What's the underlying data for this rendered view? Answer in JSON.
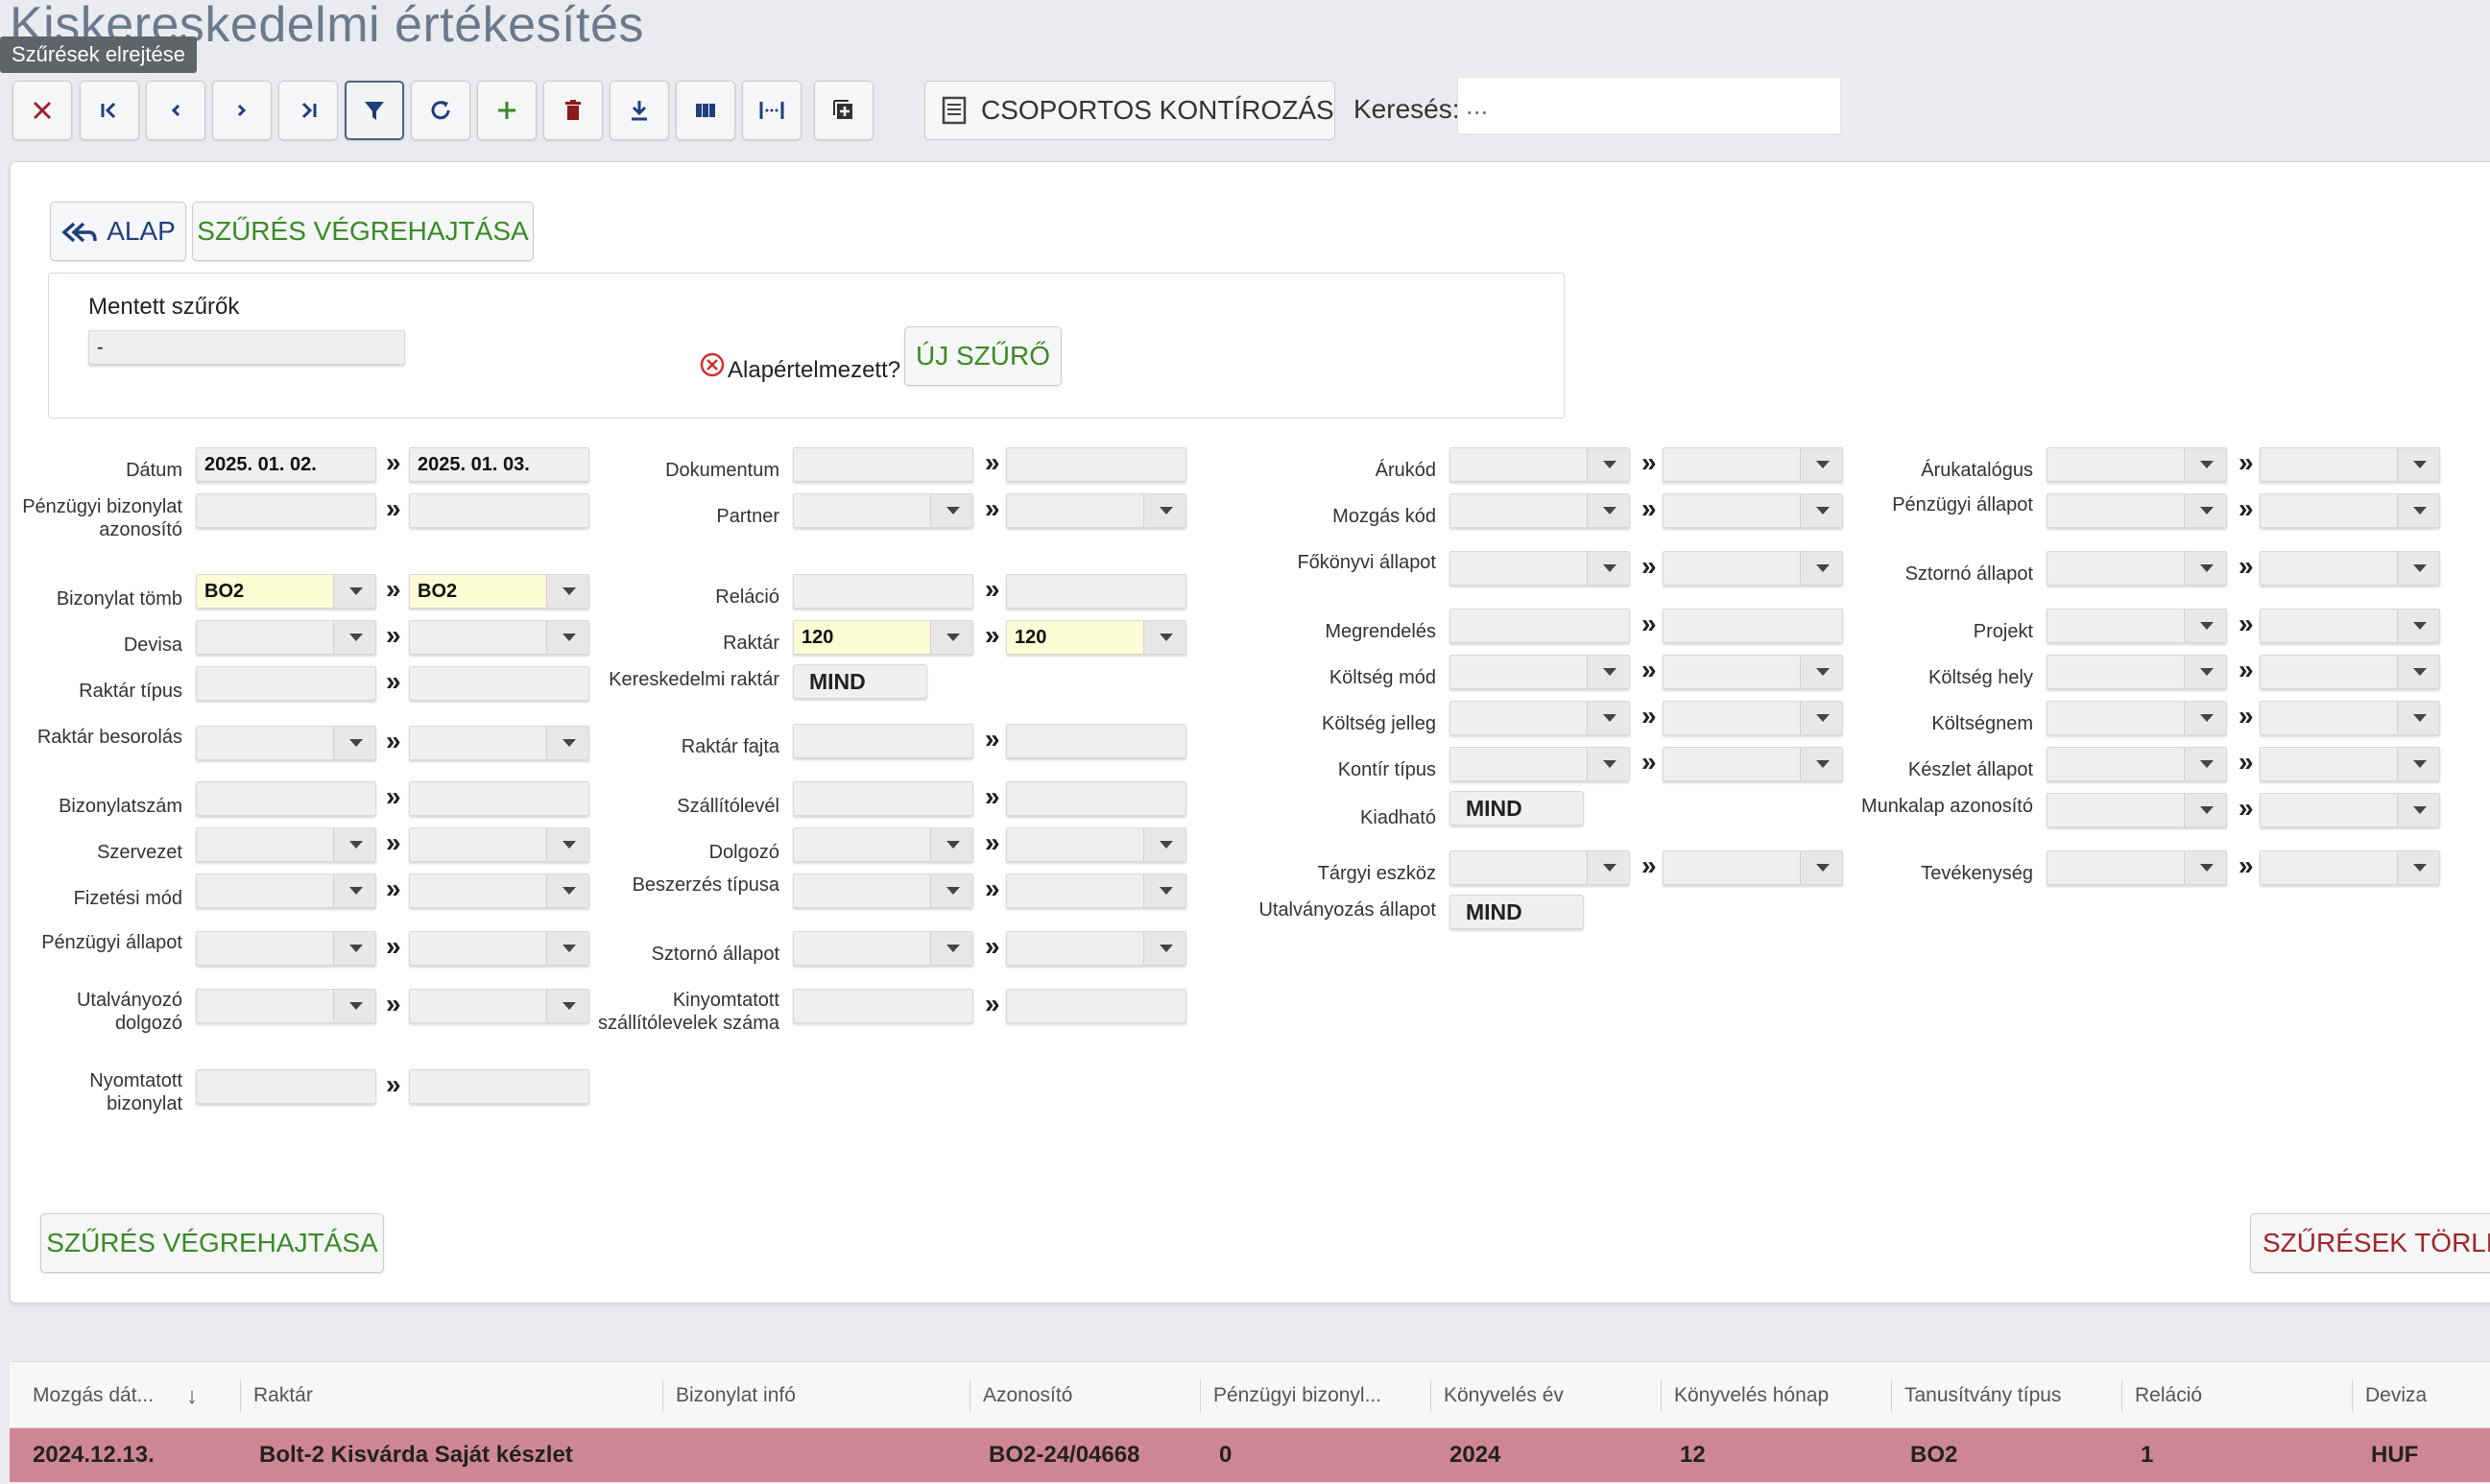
{
  "page": {
    "title": "Kiskereskedelmi értékesítés",
    "tooltip": "Szűrések elrejtése"
  },
  "toolbar": {
    "buttons": [
      "close",
      "first",
      "prev",
      "next",
      "last",
      "filter",
      "refresh",
      "add",
      "delete",
      "download",
      "columns",
      "spacing",
      "new-window"
    ],
    "group_label": "CSOPORTOS KONTÍROZÁS",
    "search_label": "Keresés:",
    "search_placeholder": "..."
  },
  "filters": {
    "back_label": "ALAP",
    "apply_label": "SZŰRÉS VÉGREHAJTÁSA",
    "saved_title": "Mentett szűrők",
    "saved_value": "-",
    "default_label": "Alapértelmezett?",
    "new_filter_label": "ÚJ SZŰRŐ",
    "apply_bottom_label": "SZŰRÉS VÉGREHAJTÁSA",
    "clear_label": "SZŰRÉSEK TÖRLÉSE",
    "sep": "»",
    "col1": {
      "datum": "Dátum",
      "datum_from": "2025. 01. 02.",
      "datum_to": "2025. 01. 03.",
      "penzugyi_azon": "Pénzügyi bizonylat azonosító",
      "bizonylat_tomb": "Bizonylat tömb",
      "tomb_from": "BO2",
      "tomb_to": "BO2",
      "devisa": "Devisa",
      "raktar_tipus": "Raktár típus",
      "raktar_besorolas": "Raktár besorolás",
      "bizonylatszam": "Bizonylatszám",
      "szervezet": "Szervezet",
      "fizetesi_mod": "Fizetési mód",
      "penzugyi_allapot": "Pénzügyi állapot",
      "utalvanyozo": "Utalványozó dolgozó",
      "nyomtatott": "Nyomtatott bizonylat"
    },
    "col2": {
      "dokumentum": "Dokumentum",
      "partner": "Partner",
      "relacio": "Reláció",
      "raktar": "Raktár",
      "raktar_from": "120",
      "raktar_to": "120",
      "ker_raktar": "Kereskedelmi raktár",
      "mind": "MIND",
      "raktar_fajta": "Raktár fajta",
      "szallitolevel": "Szállítólevél",
      "dolgozo": "Dolgozó",
      "beszerzes": "Beszerzés típusa",
      "sztorno": "Sztornó állapot",
      "kinyomtatott": "Kinyomtatott szállítólevelek száma"
    },
    "col3": {
      "arukod": "Árukód",
      "mozgas_kod": "Mozgás kód",
      "fokonyvi": "Főkönyvi állapot",
      "megrendeles": "Megrendelés",
      "koltseg_mod": "Költség mód",
      "koltseg_jelleg": "Költség jelleg",
      "kontir_tipus": "Kontír típus",
      "kiadhato": "Kiadható",
      "kiadhato_val": "MIND",
      "targyi": "Tárgyi eszköz",
      "utalvanyozas": "Utalványozás állapot",
      "utalvanyozas_val": "MIND"
    },
    "col4": {
      "arukatalogus": "Árukatalógus",
      "penzugyi_allapot": "Pénzügyi állapot",
      "sztorno": "Sztornó állapot",
      "projekt": "Projekt",
      "koltseg_hely": "Költség hely",
      "koltsegnem": "Költségnem",
      "keszlet": "Készlet állapot",
      "munkalap": "Munkalap azonosító",
      "tevekenyseg": "Tevékenység"
    }
  },
  "grid": {
    "headers": [
      "Mozgás dát...",
      "Raktár",
      "Bizonylat infó",
      "Azonosító",
      "Pénzügyi bizonyl...",
      "Könyvelés év",
      "Könyvelés hónap",
      "Tanusítvány típus",
      "Reláció",
      "Deviza"
    ],
    "rows": [
      [
        "2024.12.13.",
        "Bolt-2 Kisvárda Saját készlet",
        "",
        "BO2-24/04668",
        "0",
        "2024",
        "12",
        "BO2",
        "1",
        "HUF"
      ]
    ],
    "row_color": "#cf8693"
  }
}
